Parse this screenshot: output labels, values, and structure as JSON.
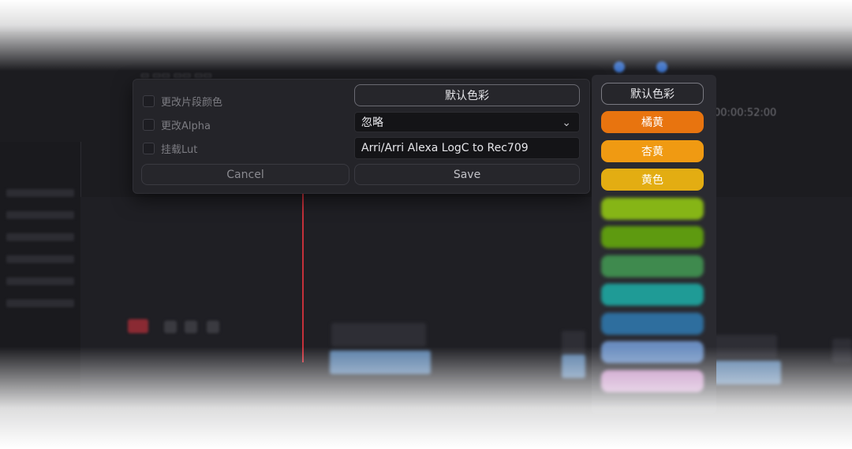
{
  "timeline": {
    "timecode": "00:00:52:00"
  },
  "dialog": {
    "options": [
      {
        "label": "更改片段颜色"
      },
      {
        "label": "更改Alpha"
      },
      {
        "label": "挂载Lut"
      }
    ],
    "default_color_label": "默认色彩",
    "alpha_select_value": "忽略",
    "lut_value": "Arri/Arri Alexa LogC to Rec709",
    "cancel_label": "Cancel",
    "save_label": "Save"
  },
  "color_panel": {
    "default_label": "默认色彩",
    "colors": [
      {
        "label": "橘黄",
        "color": "#e8740f"
      },
      {
        "label": "杏黄",
        "color": "#f09a12"
      },
      {
        "label": "黄色",
        "color": "#e3ad12"
      },
      {
        "label": "",
        "color": "#86b516"
      },
      {
        "label": "",
        "color": "#5e9a10"
      },
      {
        "label": "",
        "color": "#3f8a4e"
      },
      {
        "label": "",
        "color": "#1f9b96"
      },
      {
        "label": "",
        "color": "#2e6e9e"
      },
      {
        "label": "",
        "color": "#6b8ec0"
      },
      {
        "label": "",
        "color": "#c08bc0"
      }
    ]
  }
}
